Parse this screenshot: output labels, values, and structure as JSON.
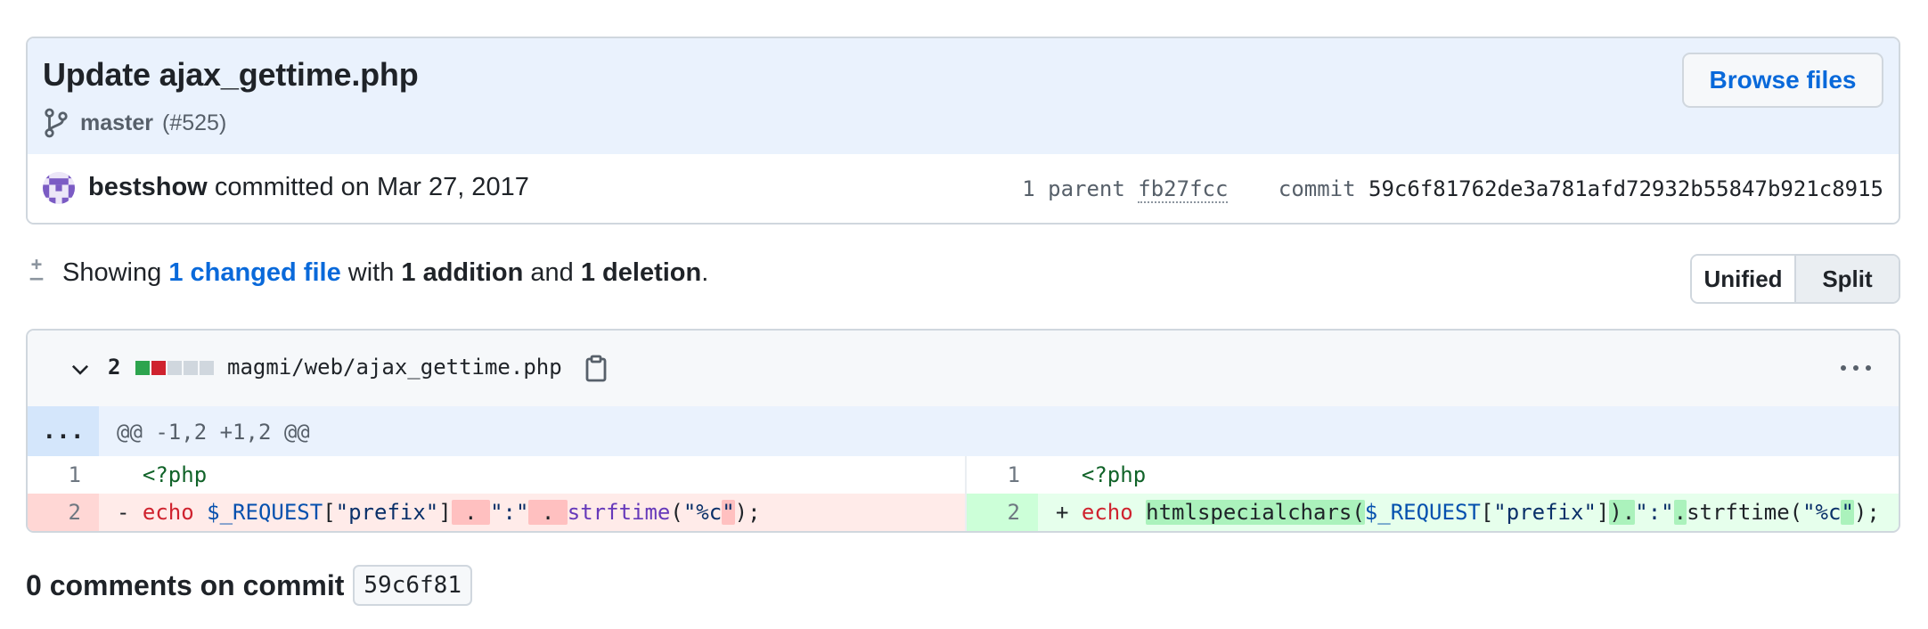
{
  "commit": {
    "title": "Update ajax_gettime.php",
    "branch": "master",
    "pr": "(#525)",
    "browse_label": "Browse files",
    "author": "bestshow",
    "committed_text": "committed on Mar 27, 2017",
    "parent_label": "1 parent",
    "parent_hash": "fb27fcc",
    "commit_label": "commit",
    "commit_hash": "59c6f81762de3a781afd72932b55847b921c8915"
  },
  "summary": {
    "showing": "Showing",
    "changed_files": "1 changed file",
    "with": "with",
    "additions": "1 addition",
    "and": "and",
    "deletions": "1 deletion",
    "period": "."
  },
  "view_toggle": {
    "unified": "Unified",
    "split": "Split",
    "selected": "Split"
  },
  "file": {
    "change_count": "2",
    "diffstat": [
      "added",
      "deleted",
      "neutral",
      "neutral",
      "neutral"
    ],
    "path": "magmi/web/ajax_gettime.php",
    "hunk_expand": "...",
    "hunk_header": "@@ -1,2 +1,2 @@",
    "left_lines": [
      {
        "num": "1",
        "type": "context",
        "marker": " ",
        "tokens": [
          {
            "t": "<?php",
            "c": "tag"
          }
        ]
      },
      {
        "num": "2",
        "type": "del",
        "marker": "-",
        "tokens": [
          {
            "t": "echo",
            "c": "kw"
          },
          {
            "t": " ",
            "c": ""
          },
          {
            "t": "$_REQUEST",
            "c": "vr"
          },
          {
            "t": "[",
            "c": ""
          },
          {
            "t": "\"prefix\"",
            "c": "st"
          },
          {
            "t": "]",
            "c": ""
          },
          {
            "t": " . ",
            "c": "hl-del"
          },
          {
            "t": "\":\"",
            "c": "st"
          },
          {
            "t": " . ",
            "c": "hl-del"
          },
          {
            "t": "strftime",
            "c": "fn"
          },
          {
            "t": "(",
            "c": ""
          },
          {
            "t": "\"%c",
            "c": "st"
          },
          {
            "t": "\"",
            "c": "st hl-del"
          },
          {
            "t": ");",
            "c": ""
          }
        ]
      }
    ],
    "right_lines": [
      {
        "num": "1",
        "type": "context",
        "marker": " ",
        "tokens": [
          {
            "t": "<?php",
            "c": "tag"
          }
        ]
      },
      {
        "num": "2",
        "type": "add",
        "marker": "+",
        "tokens": [
          {
            "t": "echo",
            "c": "kw"
          },
          {
            "t": " ",
            "c": ""
          },
          {
            "t": "htmlspecialchars(",
            "c": "hl-add"
          },
          {
            "t": "$_REQUEST",
            "c": "vr"
          },
          {
            "t": "[",
            "c": ""
          },
          {
            "t": "\"prefix\"",
            "c": "st"
          },
          {
            "t": "]",
            "c": ""
          },
          {
            "t": ").",
            "c": "hl-add"
          },
          {
            "t": "\":\"",
            "c": "st"
          },
          {
            "t": ".",
            "c": "hl-add"
          },
          {
            "t": "strftime",
            "c": ""
          },
          {
            "t": "(",
            "c": ""
          },
          {
            "t": "\"%c",
            "c": "st"
          },
          {
            "t": "\"",
            "c": "st hl-add"
          },
          {
            "t": ");",
            "c": ""
          }
        ]
      }
    ]
  },
  "comments": {
    "heading": "0 comments on commit",
    "commit_short": "59c6f81"
  },
  "colors": {
    "link": "#0969da",
    "added": "#2da44e",
    "deleted": "#cf222e",
    "neutral": "#d0d7de"
  }
}
